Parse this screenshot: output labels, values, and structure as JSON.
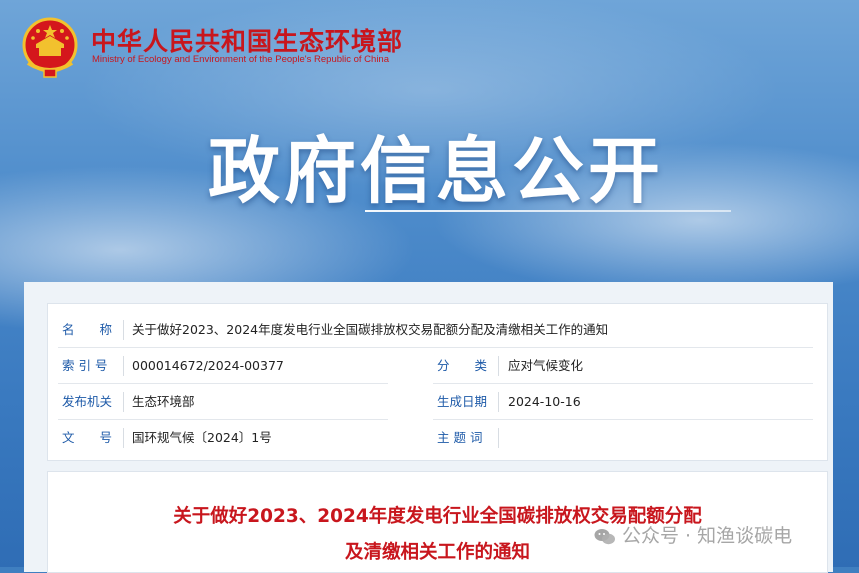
{
  "header": {
    "ministry_cn": "中华人民共和国生态环境部",
    "ministry_en": "Ministry of Ecology and Environment of the People's Republic of China",
    "section_title": "政府信息公开"
  },
  "meta": {
    "name_label": "名　　称",
    "name_value": "关于做好2023、2024年度发电行业全国碳排放权交易配额分配及清缴相关工作的通知",
    "index_label": "索 引 号",
    "index_value": "000014672/2024-00377",
    "category_label": "分　　类",
    "category_value": "应对气候变化",
    "issuer_label": "发布机关",
    "issuer_value": "生态环境部",
    "date_label": "生成日期",
    "date_value": "2024-10-16",
    "docno_label": "文　　号",
    "docno_value": "国环规气候〔2024〕1号",
    "topic_label": "主 题 词",
    "topic_value": ""
  },
  "document": {
    "title_line1": "关于做好2023、2024年度发电行业全国碳排放权交易配额分配",
    "title_line2": "及清缴相关工作的通知"
  },
  "watermark": {
    "text": "公众号 · 知渔谈碳电"
  },
  "colors": {
    "brand_red": "#c8161d",
    "label_blue": "#1e5aa8",
    "sky_blue": "#3f7fc0"
  }
}
